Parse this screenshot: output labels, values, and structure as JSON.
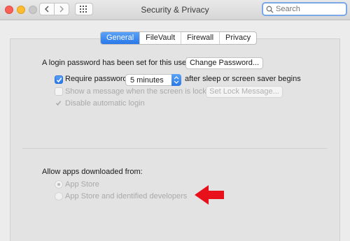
{
  "window": {
    "title": "Security & Privacy"
  },
  "search": {
    "placeholder": "Search"
  },
  "tabs": [
    {
      "label": "General",
      "active": true
    },
    {
      "label": "FileVault",
      "active": false
    },
    {
      "label": "Firewall",
      "active": false
    },
    {
      "label": "Privacy",
      "active": false
    }
  ],
  "general": {
    "login_password_text": "A login password has been set for this user",
    "change_password_label": "Change Password...",
    "require_password_label": "Require password",
    "require_password_checked": true,
    "require_password_delay": "5 minutes",
    "after_sleep_text": "after sleep or screen saver begins",
    "show_message_label": "Show a message when the screen is locked",
    "set_lock_message_label": "Set Lock Message...",
    "disable_auto_login_label": "Disable automatic login"
  },
  "downloads": {
    "heading": "Allow apps downloaded from:",
    "options": [
      {
        "label": "App Store",
        "selected": true
      },
      {
        "label": "App Store and identified developers",
        "selected": false
      }
    ]
  },
  "colors": {
    "accent": "#2a78e8",
    "annotation_arrow": "#e8101a"
  },
  "icons": [
    "back-chevron-icon",
    "forward-chevron-icon",
    "grid-icon",
    "search-icon",
    "checkmark-icon",
    "dropdown-arrows-icon"
  ]
}
